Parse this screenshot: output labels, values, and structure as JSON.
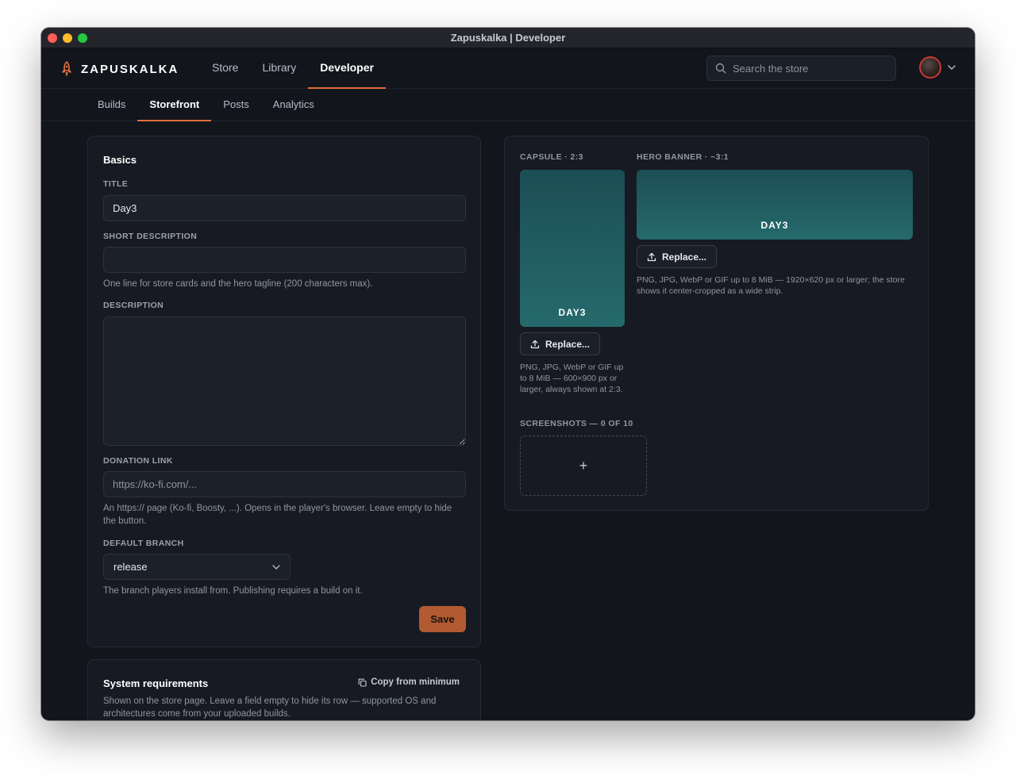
{
  "window": {
    "title": "Zapuskalka | Developer"
  },
  "header": {
    "brand": "ZAPUSKALKA",
    "nav": [
      {
        "label": "Store",
        "active": false
      },
      {
        "label": "Library",
        "active": false
      },
      {
        "label": "Developer",
        "active": true
      }
    ],
    "search": {
      "placeholder": "Search the store",
      "value": ""
    }
  },
  "subnav": {
    "tabs": [
      {
        "label": "Builds",
        "active": false
      },
      {
        "label": "Storefront",
        "active": true
      },
      {
        "label": "Posts",
        "active": false
      },
      {
        "label": "Analytics",
        "active": false
      }
    ]
  },
  "basics": {
    "title": "Basics",
    "title_field": {
      "label": "TITLE",
      "value": "Day3"
    },
    "short_description": {
      "label": "SHORT DESCRIPTION",
      "value": "",
      "help": "One line for store cards and the hero tagline (200 characters max)."
    },
    "description": {
      "label": "DESCRIPTION",
      "value": ""
    },
    "donation_link": {
      "label": "DONATION LINK",
      "placeholder": "https://ko-fi.com/...",
      "value": "",
      "help": "An https:// page (Ko-fi, Boosty, ...). Opens in the player's browser. Leave empty to hide the button."
    },
    "default_branch": {
      "label": "DEFAULT BRANCH",
      "value": "release",
      "help": "The branch players install from. Publishing requires a build on it."
    },
    "save_label": "Save"
  },
  "system_requirements": {
    "title": "System requirements",
    "copy_label": "Copy from minimum",
    "help": "Shown on the store page. Leave a field empty to hide its row — supported OS and architectures come from your uploaded builds."
  },
  "media": {
    "capsule": {
      "label": "CAPSULE · 2:3",
      "game_name": "DAY3",
      "replace_label": "Replace...",
      "help": "PNG, JPG, WebP or GIF up to 8 MiB — 600×900 px or larger, always shown at 2:3."
    },
    "hero": {
      "label": "HERO BANNER · ~3:1",
      "game_name": "DAY3",
      "replace_label": "Replace...",
      "help": "PNG, JPG, WebP or GIF up to 8 MiB — 1920×620 px or larger; the store shows it center-cropped as a wide strip."
    },
    "screenshots": {
      "label": "SCREENSHOTS — 0 OF 10",
      "add_symbol": "+"
    }
  },
  "colors": {
    "accent": "#e06f3c",
    "save_button": "#b25a32",
    "artwork_teal": "#256a6c",
    "background": "#12151c",
    "card": "#171a22"
  },
  "icons": [
    "rocket-icon",
    "search-icon",
    "chevron-down-icon",
    "upload-icon",
    "copy-icon",
    "plus-icon"
  ]
}
